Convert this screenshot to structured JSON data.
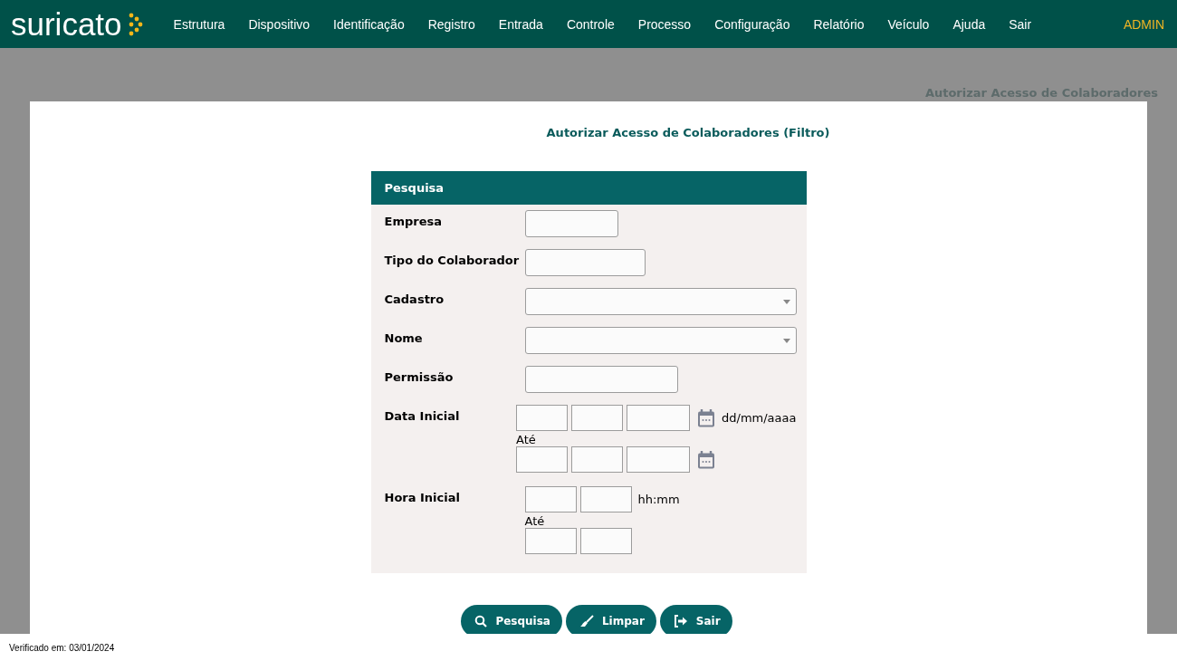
{
  "brand": {
    "name": "suricato"
  },
  "menu": [
    {
      "label": "Estrutura"
    },
    {
      "label": "Dispositivo"
    },
    {
      "label": "Identificação"
    },
    {
      "label": "Registro"
    },
    {
      "label": "Entrada"
    },
    {
      "label": "Controle"
    },
    {
      "label": "Processo"
    },
    {
      "label": "Configuração"
    },
    {
      "label": "Relatório"
    },
    {
      "label": "Veículo"
    },
    {
      "label": "Ajuda"
    },
    {
      "label": "Sair"
    }
  ],
  "user": "ADMIN",
  "breadcrumb": "Autorizar Acesso de Colaboradores",
  "page_title": "Autorizar Acesso de Colaboradores (Filtro)",
  "form": {
    "title": "Pesquisa",
    "fields": [
      {
        "label": "Empresa",
        "kind": "text"
      },
      {
        "label": "Tipo do Colaborador",
        "kind": "text"
      },
      {
        "label": "Cadastro",
        "kind": "select"
      },
      {
        "label": "Nome",
        "kind": "select"
      },
      {
        "label": "Permissão",
        "kind": "text"
      },
      {
        "label": "Data Inicial",
        "kind": "date",
        "hint": "dd/mm/aaaa",
        "range_label": "Até"
      },
      {
        "label": "Hora Inicial",
        "kind": "time",
        "hint": "hh:mm",
        "range_label": "Até"
      }
    ]
  },
  "buttons": [
    {
      "label": "Pesquisa",
      "kind": "search"
    },
    {
      "label": "Limpar",
      "kind": "clear"
    },
    {
      "label": "Sair",
      "kind": "exit"
    }
  ],
  "footer": "Verificado em: 03/01/2024"
}
